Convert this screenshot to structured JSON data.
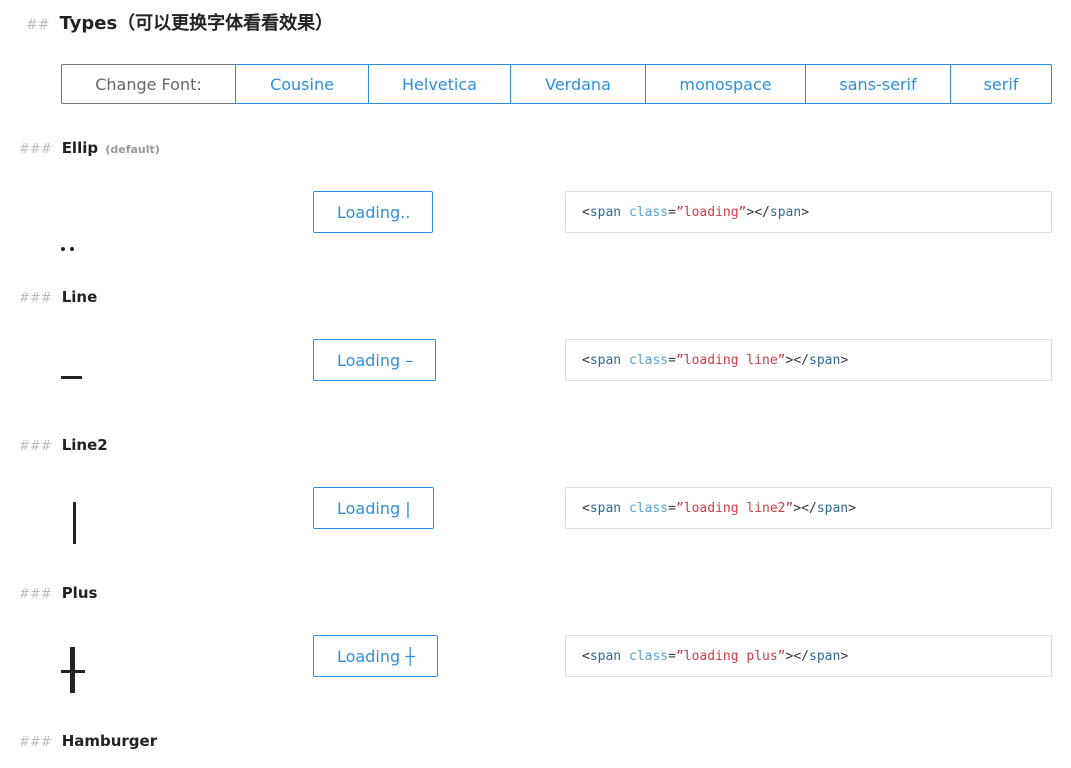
{
  "heading": {
    "hash": "##",
    "title": "Types（可以更换字体看看效果）"
  },
  "font_bar": {
    "label": "Change Font:",
    "options": [
      "Cousine",
      "Helvetica",
      "Verdana",
      "monospace",
      "sans-serif",
      "serif"
    ]
  },
  "sections": [
    {
      "hash": "###",
      "title": "Ellip",
      "note": "(default)",
      "demo_glyph": "dots-icon",
      "button_label": "Loading..",
      "code": {
        "open": "<",
        "tag": "span",
        "attr": "class",
        "eq": "=",
        "value": "”loading”",
        "close": "></",
        "tag2": "span",
        "end": ">"
      }
    },
    {
      "hash": "###",
      "title": "Line",
      "note": "",
      "demo_glyph": "line-icon",
      "button_label": "Loading –",
      "code": {
        "open": "<",
        "tag": "span",
        "attr": "class",
        "eq": "=",
        "value": "”loading line”",
        "close": "></",
        "tag2": "span",
        "end": ">"
      }
    },
    {
      "hash": "###",
      "title": "Line2",
      "note": "",
      "demo_glyph": "vertical-line-icon",
      "button_label": "Loading  |",
      "code": {
        "open": "<",
        "tag": "span",
        "attr": "class",
        "eq": "=",
        "value": "”loading line2”",
        "close": "></",
        "tag2": "span",
        "end": ">"
      }
    },
    {
      "hash": "###",
      "title": "Plus",
      "note": "",
      "demo_glyph": "plus-icon",
      "button_label": "Loading ┼",
      "code": {
        "open": "<",
        "tag": "span",
        "attr": "class",
        "eq": "=",
        "value": "”loading plus”",
        "close": "></",
        "tag2": "span",
        "end": ">"
      }
    },
    {
      "hash": "###",
      "title": "Hamburger",
      "note": ""
    }
  ],
  "colors": {
    "accent": "#2f8fdf",
    "code_tag": "#2b6a94",
    "code_attr": "#5aa0d0",
    "code_string": "#cc3c46"
  }
}
